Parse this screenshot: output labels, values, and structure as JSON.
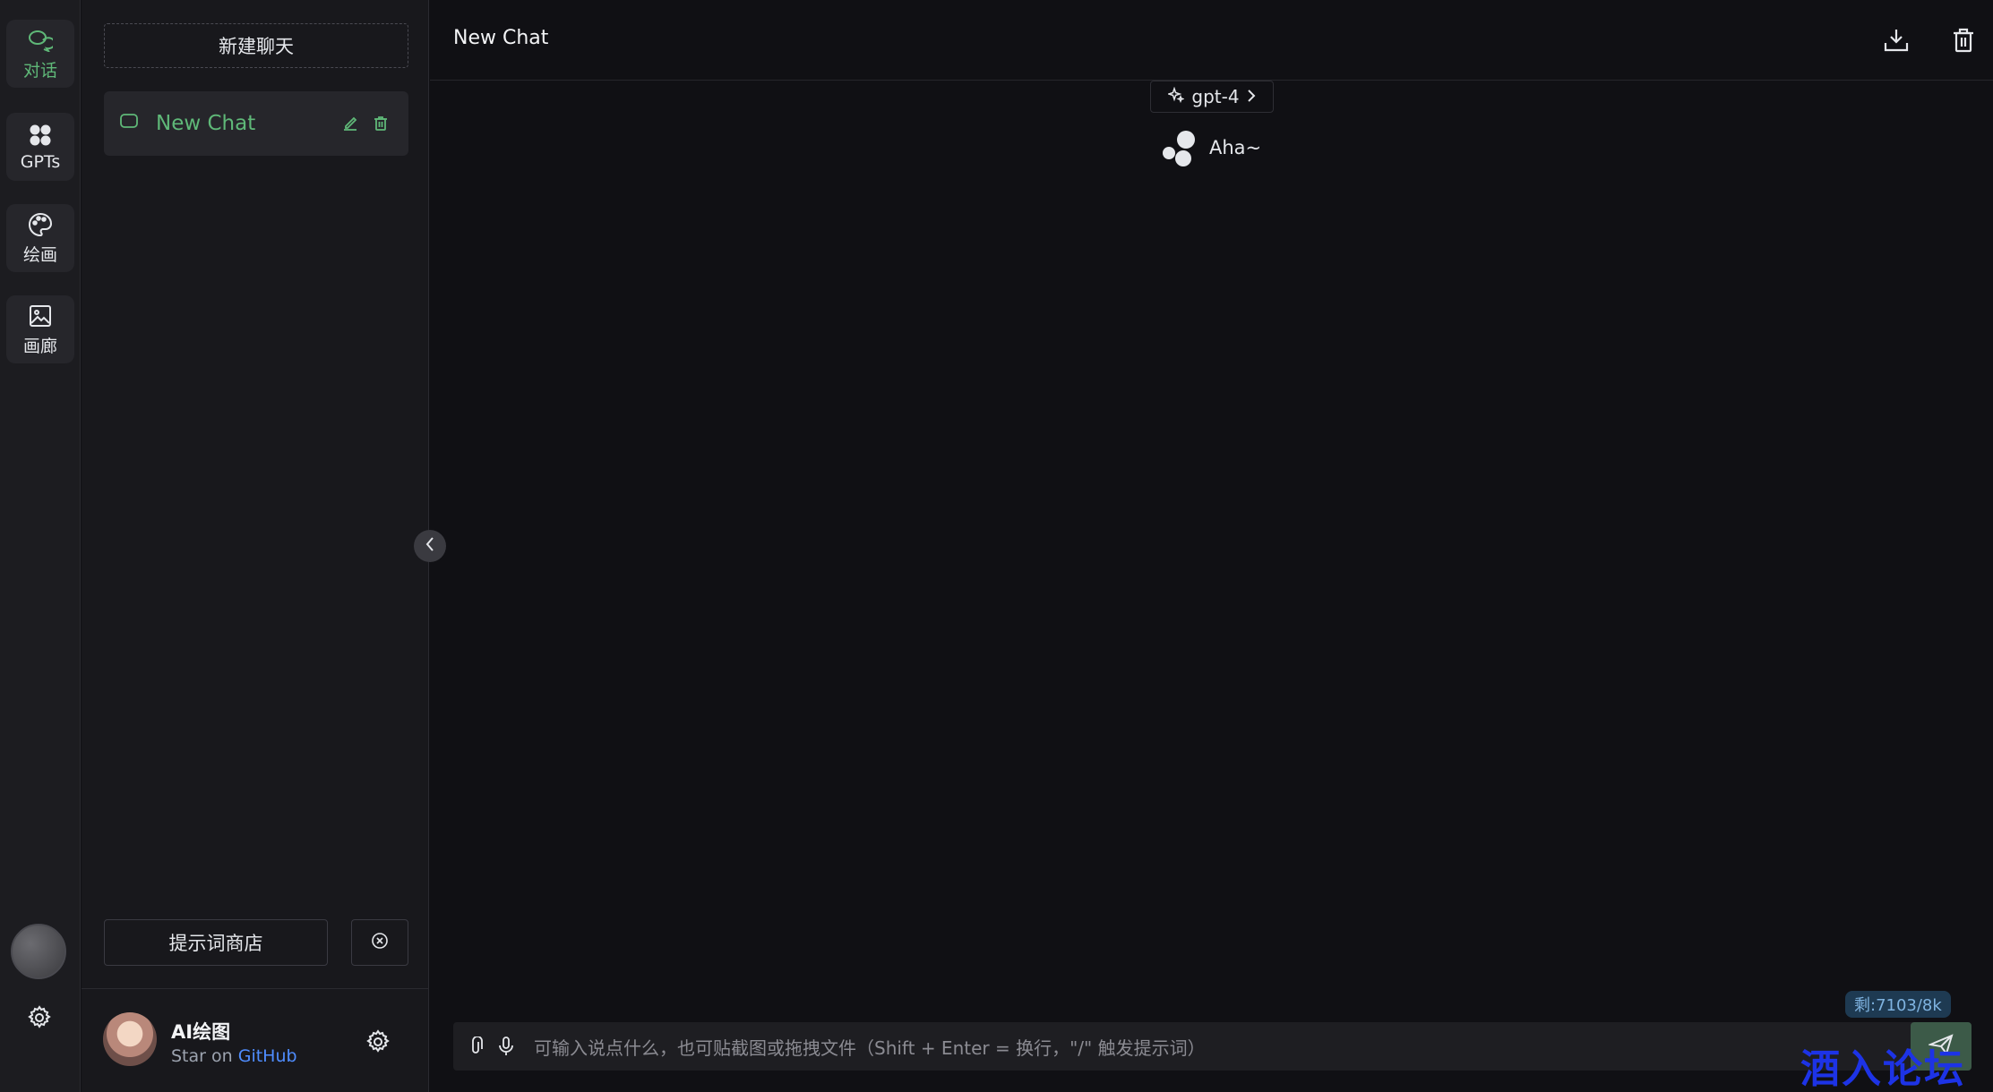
{
  "rail": {
    "items": [
      {
        "label": "对话",
        "icon": "chat-icon",
        "active": true
      },
      {
        "label": "GPTs",
        "icon": "apps-icon",
        "active": false
      },
      {
        "label": "绘画",
        "icon": "palette-icon",
        "active": false
      },
      {
        "label": "画廊",
        "icon": "image-icon",
        "active": false
      }
    ]
  },
  "sidebar": {
    "new_chat_label": "新建聊天",
    "chats": [
      {
        "title": "New Chat"
      }
    ],
    "prompt_store_label": "提示词商店",
    "footer": {
      "name": "AI绘图",
      "sub_prefix": "Star on",
      "sub_link": "GitHub"
    }
  },
  "main": {
    "title": "New Chat",
    "model": "gpt-4",
    "bot_greeting": "Aha~",
    "token_badge": "剩:7103/8k",
    "input_placeholder": "可输入说点什么，也可贴截图或拖拽文件（Shift + Enter = 换行，\"/\" 触发提示词）"
  },
  "watermark": "酒入论坛",
  "colors": {
    "accent": "#5fb878",
    "background": "#101014",
    "sidebar": "#18181c",
    "link": "#4f8dff"
  }
}
